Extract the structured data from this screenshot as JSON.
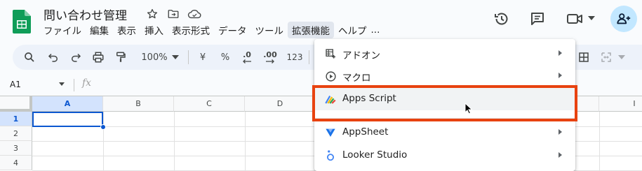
{
  "doc": {
    "title": "問い合わせ管理"
  },
  "menubar": {
    "items": [
      "ファイル",
      "編集",
      "表示",
      "挿入",
      "表示形式",
      "データ",
      "ツール",
      "拡張機能",
      "ヘルプ",
      "..."
    ]
  },
  "toolbar": {
    "zoom": "100%",
    "currency": "¥",
    "percent": "%",
    "decrease_decimal": ".0",
    "increase_decimal": ".00",
    "number_format": "123"
  },
  "formula_bar": {
    "name_box": "A1",
    "fx": "fx"
  },
  "grid": {
    "columns": [
      "A",
      "B",
      "C",
      "D",
      "I"
    ],
    "rows": [
      "1",
      "2",
      "3",
      "4"
    ]
  },
  "extensions_menu": {
    "items": [
      {
        "label": "アドオン",
        "icon": "addon-icon",
        "submenu": true
      },
      {
        "label": "マクロ",
        "icon": "macro-play-icon",
        "submenu": true
      },
      {
        "label": "Apps Script",
        "icon": "apps-script-icon",
        "submenu": false
      },
      {
        "label": "AppSheet",
        "icon": "appsheet-icon",
        "submenu": true
      },
      {
        "label": "Looker Studio",
        "icon": "looker-studio-icon",
        "submenu": true
      }
    ]
  },
  "colors": {
    "accent": "#0b57d0",
    "highlight": "#e8420f",
    "sheets_green": "#0f9d58",
    "avatar_bg": "#c2e7ff"
  }
}
